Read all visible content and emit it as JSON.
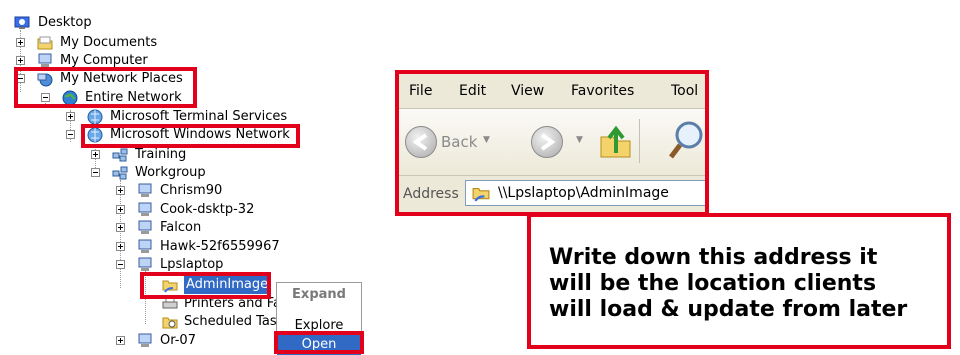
{
  "tree": {
    "items": [
      {
        "label": "Desktop",
        "icon": "desktop-icon"
      },
      {
        "label": "My Documents",
        "icon": "folder-icon"
      },
      {
        "label": "My Computer",
        "icon": "computer-icon"
      },
      {
        "label": "My Network Places",
        "icon": "network-places-icon"
      },
      {
        "label": "Entire Network",
        "icon": "globe-icon"
      },
      {
        "label": "Microsoft Terminal Services",
        "icon": "network-globe-icon"
      },
      {
        "label": "Microsoft Windows Network",
        "icon": "network-globe-icon"
      },
      {
        "label": "Training",
        "icon": "workgroup-icon"
      },
      {
        "label": "Workgroup",
        "icon": "workgroup-icon"
      },
      {
        "label": "Chrism90",
        "icon": "computer-icon"
      },
      {
        "label": "Cook-dsktp-32",
        "icon": "computer-icon"
      },
      {
        "label": "Falcon",
        "icon": "computer-icon"
      },
      {
        "label": "Hawk-52f6559967",
        "icon": "computer-icon"
      },
      {
        "label": "Lpslaptop",
        "icon": "computer-icon"
      },
      {
        "label": "AdminImage",
        "icon": "shared-folder-icon"
      },
      {
        "label": "Printers and Fa",
        "icon": "printer-icon"
      },
      {
        "label": "Scheduled Tas",
        "icon": "scheduled-tasks-icon"
      },
      {
        "label": "Or-07",
        "icon": "computer-icon"
      }
    ]
  },
  "context_menu": {
    "items": [
      "Expand",
      "Explore",
      "Open"
    ]
  },
  "explorer": {
    "menu": [
      "File",
      "Edit",
      "View",
      "Favorites",
      "Tool"
    ],
    "back_label": "Back",
    "address_label": "Address",
    "address_value": "\\\\Lpslaptop\\AdminImage"
  },
  "callout": {
    "lines": [
      "Write down this address it",
      "will be the location clients",
      "will load & update from later"
    ]
  },
  "colors": {
    "highlight_red": "#e3001b",
    "selection_blue": "#316ac5"
  }
}
